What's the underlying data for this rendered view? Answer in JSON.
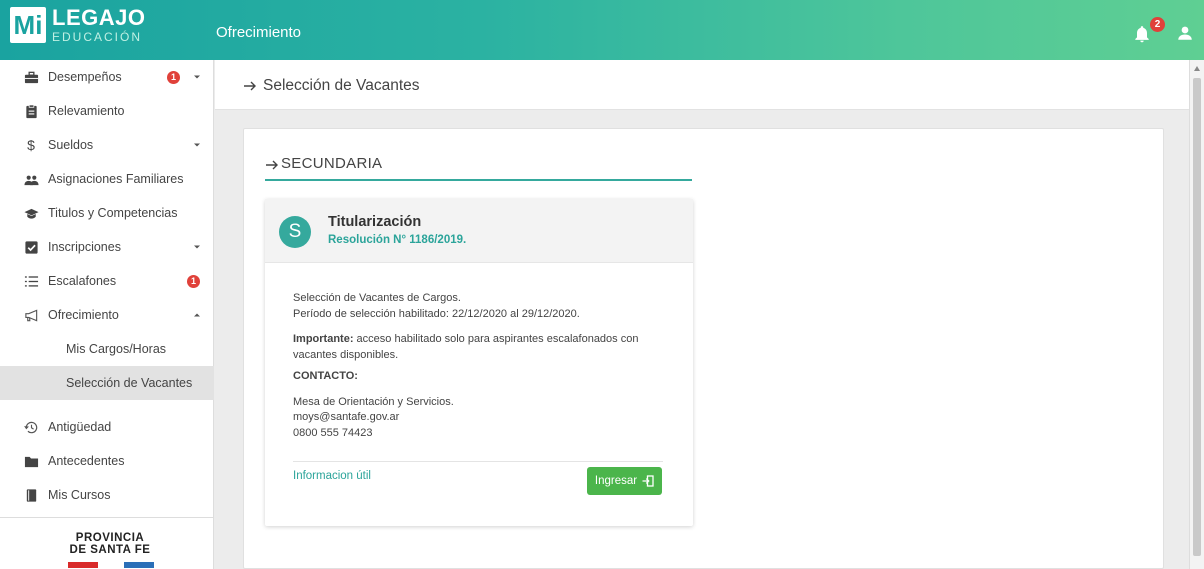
{
  "brand": {
    "mi": "Mi",
    "title": "LEGAJO",
    "subtitle": "EDUCACIÓN"
  },
  "header": {
    "title": "Ofrecimiento",
    "notifications_count": "2"
  },
  "sidebar": {
    "items": [
      {
        "label": "Desempeños",
        "icon": "briefcase-icon",
        "badge": "1",
        "caret": "down"
      },
      {
        "label": "Relevamiento",
        "icon": "clipboard-icon"
      },
      {
        "label": "Sueldos",
        "icon": "dollar-icon",
        "caret": "down"
      },
      {
        "label": "Asignaciones Familiares",
        "icon": "people-icon"
      },
      {
        "label": "Titulos y Competencias",
        "icon": "graduation-cap-icon"
      },
      {
        "label": "Inscripciones",
        "icon": "checkbox-icon",
        "caret": "down"
      },
      {
        "label": "Escalafones",
        "icon": "list-icon",
        "badge": "1"
      },
      {
        "label": "Ofrecimiento",
        "icon": "megaphone-icon",
        "caret": "up"
      },
      {
        "label": "Antigüedad",
        "icon": "history-icon"
      },
      {
        "label": "Antecedentes",
        "icon": "folder-icon"
      },
      {
        "label": "Mis Cursos",
        "icon": "book-icon"
      }
    ],
    "subitems": [
      {
        "label": "Mis Cargos/Horas"
      },
      {
        "label": "Selección de Vacantes"
      }
    ],
    "province_logo": {
      "line1": "PROVINCIA",
      "line2": "DE SANTA FE"
    }
  },
  "main": {
    "page_title": "Selección de Vacantes",
    "section_title": "SECUNDARIA",
    "card": {
      "avatar_letter": "S",
      "title": "Titularización",
      "subtitle": "Resolución N° 1186/2019.",
      "line1": "Selección de Vacantes de Cargos.",
      "line2": "Período de selección habilitado: 22/12/2020 al 29/12/2020.",
      "important_label": "Importante:",
      "important_text": " acceso habilitado solo para aspirantes escalafonados con vacantes disponibles.",
      "contact_label": "CONTACTO:",
      "contact_line1": "Mesa de Orientación y Servicios.",
      "contact_line2": "moys@santafe.gov.ar",
      "contact_line3": "0800 555 74423",
      "info_link": "Informacion útil",
      "button_label": "Ingresar"
    }
  },
  "colors": {
    "teal": "#35a99d",
    "green_button": "#4bb54b",
    "badge_red": "#e0413a"
  }
}
